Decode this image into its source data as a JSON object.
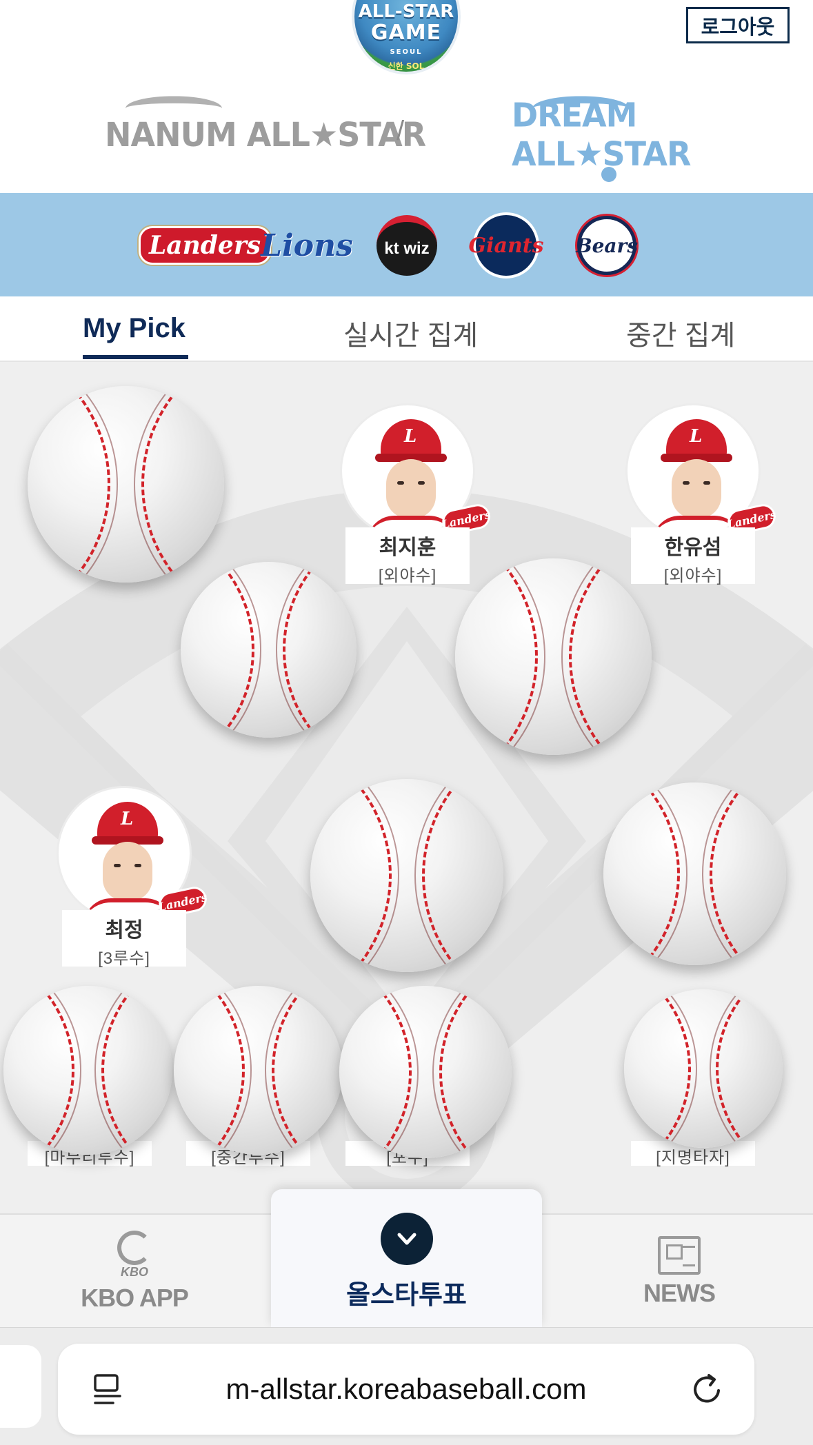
{
  "header": {
    "event_logo": {
      "line1": "ALL-STAR",
      "line2": "GAME",
      "line3": "SEOUL",
      "line4": "신한 SOL"
    },
    "logout_label": "로그아웃",
    "team_tabs": [
      {
        "label": "NANUM ALL★STAR",
        "active": false
      },
      {
        "label": "DREAM ALL★STAR",
        "active": true
      }
    ],
    "divider": "/"
  },
  "teams": [
    {
      "name": "Landers",
      "icon": "ssg-landers-logo"
    },
    {
      "name": "Lions",
      "icon": "samsung-lions-logo"
    },
    {
      "name": "kt wiz",
      "icon": "kt-wiz-logo"
    },
    {
      "name": "Giants",
      "icon": "lotte-giants-logo"
    },
    {
      "name": "Bears",
      "icon": "doosan-bears-logo"
    }
  ],
  "subtabs": [
    {
      "label": "My Pick",
      "active": true
    },
    {
      "label": "실시간 집계",
      "active": false
    },
    {
      "label": "중간 집계",
      "active": false
    }
  ],
  "picks": [
    {
      "name": "최지훈",
      "position": "[외야수]",
      "team_badge": "Landers"
    },
    {
      "name": "한유섬",
      "position": "[외야수]",
      "team_badge": "Landers"
    },
    {
      "name": "최정",
      "position": "[3루수]",
      "team_badge": "Landers"
    }
  ],
  "hidden_positions": [
    "[마무리투수]",
    "[중간투수]",
    "[포수]",
    "[지명타자]"
  ],
  "bottom_nav": {
    "kbo_sub": "KBO",
    "kbo_label": "KBO APP",
    "vote_label": "올스타투표",
    "news_label": "NEWS"
  },
  "browser": {
    "url": "m-allstar.koreabaseball.com"
  },
  "colors": {
    "brand_navy": "#0f2a57",
    "dream_blue": "#7fb4de",
    "teams_band": "#9dc8e6",
    "landers_red": "#d11f2b"
  }
}
